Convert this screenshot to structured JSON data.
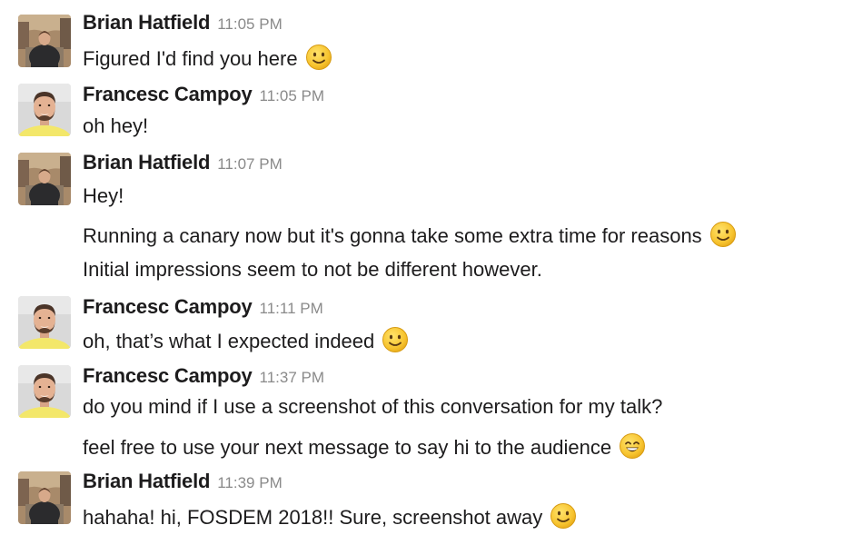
{
  "users": {
    "brian": {
      "name": "Brian Hatfield"
    },
    "francesc": {
      "name": "Francesc Campoy"
    }
  },
  "messages": [
    {
      "time": "11:05 PM",
      "lines": [
        {
          "text": "Figured I'd find you here",
          "emoji": "slightly-smiling-face-icon"
        }
      ]
    },
    {
      "time": "11:05 PM",
      "lines": [
        {
          "text": "oh hey!"
        }
      ]
    },
    {
      "time": "11:07 PM",
      "lines": [
        {
          "text": "Hey!"
        },
        {
          "text": "Running a canary now but it's gonna take some extra time for reasons",
          "emoji": "slightly-smiling-face-icon"
        },
        {
          "text": "Initial impressions seem to not be different however."
        }
      ]
    },
    {
      "time": "11:11 PM",
      "lines": [
        {
          "text": "oh, that’s what I expected indeed",
          "emoji": "slightly-smiling-face-icon"
        }
      ]
    },
    {
      "time": "11:37 PM",
      "lines": [
        {
          "text": "do you mind if I use a screenshot of this conversation for my talk?"
        },
        {
          "text": "feel free to use your next message to say hi to the audience",
          "emoji": "grinning-face-icon"
        }
      ]
    },
    {
      "time": "11:39 PM",
      "lines": [
        {
          "text": "hahaha! hi, FOSDEM 2018!! Sure, screenshot away",
          "emoji": "slightly-smiling-face-icon"
        }
      ]
    }
  ],
  "colors": {
    "name": "#1d1c1d",
    "text": "#1d1c1d",
    "timestamp": "#8a8a8a",
    "emoji_face": "#f7c430",
    "francesc_avatar_bg": "#f3e76a"
  }
}
